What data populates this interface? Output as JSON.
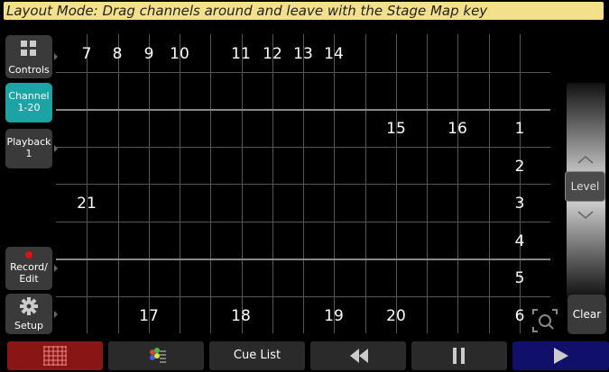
{
  "banner": "Layout Mode: Drag channels around and leave with the Stage Map key",
  "sidebar": {
    "controls": "Controls",
    "channel_line1": "Channel",
    "channel_line2": "1-20",
    "playback_line1": "Playback",
    "playback_line2": "1",
    "record_line1": "Record/",
    "record_line2": "Edit",
    "setup": "Setup"
  },
  "channels": [
    {
      "num": "7",
      "col": 0,
      "row": 0
    },
    {
      "num": "8",
      "col": 1,
      "row": 0
    },
    {
      "num": "9",
      "col": 2,
      "row": 0
    },
    {
      "num": "10",
      "col": 3,
      "row": 0
    },
    {
      "num": "11",
      "col": 5,
      "row": 0
    },
    {
      "num": "12",
      "col": 6,
      "row": 0
    },
    {
      "num": "13",
      "col": 7,
      "row": 0
    },
    {
      "num": "14",
      "col": 8,
      "row": 0
    },
    {
      "num": "15",
      "col": 10,
      "row": 2
    },
    {
      "num": "16",
      "col": 12,
      "row": 2
    },
    {
      "num": "1",
      "col": 14,
      "row": 2
    },
    {
      "num": "2",
      "col": 14,
      "row": 3
    },
    {
      "num": "21",
      "col": 0,
      "row": 4
    },
    {
      "num": "3",
      "col": 14,
      "row": 4
    },
    {
      "num": "4",
      "col": 14,
      "row": 5
    },
    {
      "num": "5",
      "col": 14,
      "row": 6
    },
    {
      "num": "17",
      "col": 2,
      "row": 7
    },
    {
      "num": "18",
      "col": 5,
      "row": 7
    },
    {
      "num": "19",
      "col": 8,
      "row": 7
    },
    {
      "num": "20",
      "col": 10,
      "row": 7
    },
    {
      "num": "6",
      "col": 14,
      "row": 7
    }
  ],
  "fader": {
    "level_label": "Level"
  },
  "clear_label": "Clear",
  "bottom_bar": {
    "grid_icon": "grid-icon",
    "color_icon": "color-palette-icon",
    "cue_list": "Cue List",
    "rewind_icon": "rewind-icon",
    "pause_icon": "pause-icon",
    "play_icon": "play-icon"
  },
  "colors": {
    "banner_bg": "#f3e08a",
    "active_tab": "#1ca3a3",
    "record_dot": "#e01010",
    "bottom_red": "#8a1515",
    "bottom_blue": "#10106b"
  }
}
